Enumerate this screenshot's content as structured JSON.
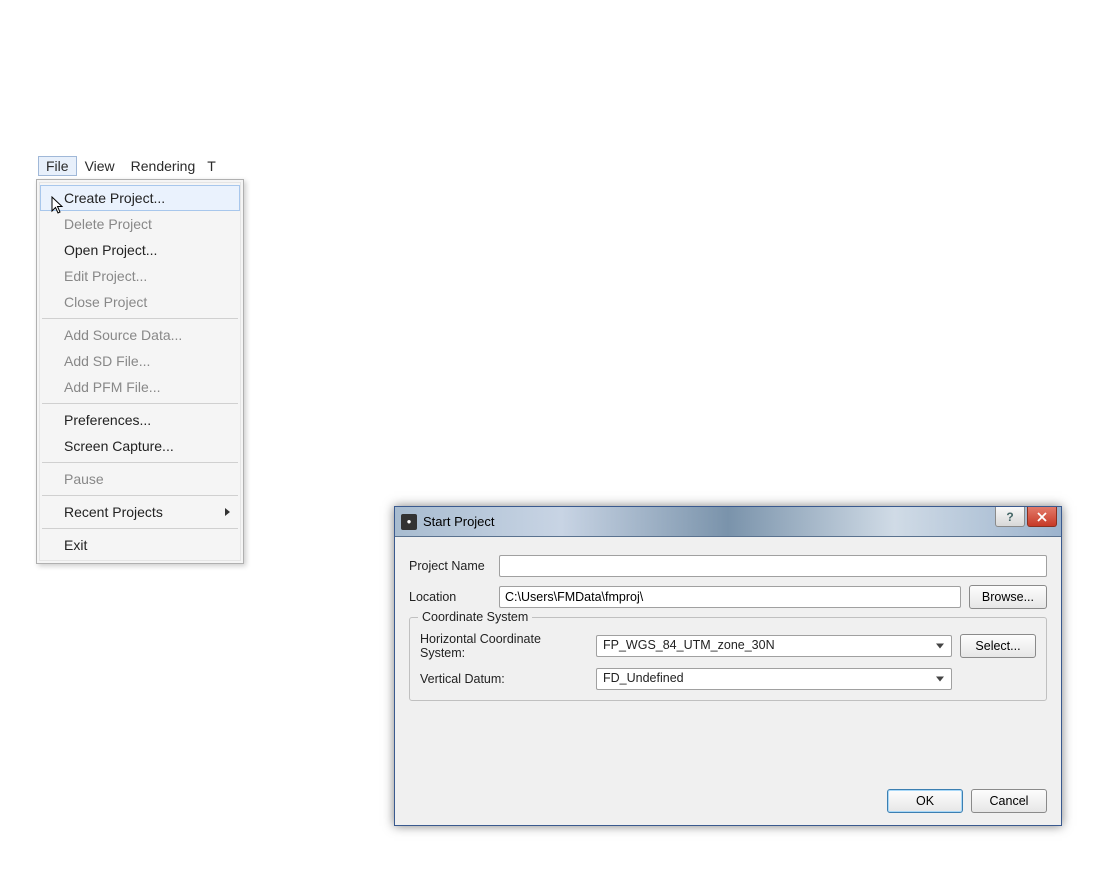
{
  "menubar": {
    "items": [
      "File",
      "View",
      "Rendering"
    ]
  },
  "dropdown": {
    "items": [
      {
        "label": "Create Project...",
        "enabled": true,
        "highlight": true
      },
      {
        "label": "Delete Project",
        "enabled": false
      },
      {
        "label": "Open Project...",
        "enabled": true
      },
      {
        "label": "Edit Project...",
        "enabled": false
      },
      {
        "label": "Close Project",
        "enabled": false
      },
      {
        "sep": true
      },
      {
        "label": "Add Source Data...",
        "enabled": false
      },
      {
        "label": "Add SD File...",
        "enabled": false
      },
      {
        "label": "Add PFM File...",
        "enabled": false
      },
      {
        "sep": true
      },
      {
        "label": "Preferences...",
        "enabled": true
      },
      {
        "label": "Screen Capture...",
        "enabled": true
      },
      {
        "sep": true
      },
      {
        "label": "Pause",
        "enabled": false
      },
      {
        "sep": true
      },
      {
        "label": "Recent Projects",
        "enabled": true,
        "submenu": true
      },
      {
        "sep": true
      },
      {
        "label": "Exit",
        "enabled": true
      }
    ]
  },
  "dialog": {
    "title": "Start Project",
    "project_name_label": "Project Name",
    "project_name_value": "",
    "location_label": "Location",
    "location_value": "C:\\Users\\FMData\\fmproj\\",
    "browse_label": "Browse...",
    "group_title": "Coordinate System",
    "hcs_label": "Horizontal Coordinate System:",
    "hcs_value": "FP_WGS_84_UTM_zone_30N",
    "select_label": "Select...",
    "vd_label": "Vertical Datum:",
    "vd_value": "FD_Undefined",
    "ok_label": "OK",
    "cancel_label": "Cancel"
  }
}
